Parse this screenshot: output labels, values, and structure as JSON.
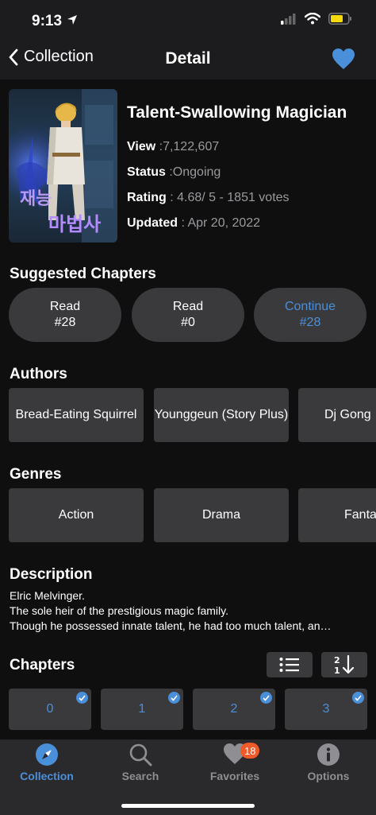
{
  "status_bar": {
    "time": "9:13"
  },
  "nav": {
    "back_label": "Collection",
    "title": "Detail"
  },
  "manga": {
    "title": "Talent-Swallowing Magician",
    "view_label": "View",
    "view_value": " :7,122,607",
    "status_label": "Status",
    "status_value": " :Ongoing",
    "rating_label": "Rating",
    "rating_value": " : 4.68/ 5  - 1851 votes",
    "updated_label": "Updated",
    "updated_value": " : Apr 20, 2022"
  },
  "suggested": {
    "title": "Suggested Chapters",
    "items": [
      {
        "line1": "Read",
        "line2": "#28"
      },
      {
        "line1": "Read",
        "line2": "#0"
      },
      {
        "line1": "Continue",
        "line2": "#28"
      }
    ]
  },
  "authors": {
    "title": "Authors",
    "items": [
      "Bread-Eating Squirrel",
      "Younggeun (Story Plus)",
      "Dj Gong"
    ]
  },
  "genres": {
    "title": "Genres",
    "items": [
      "Action",
      "Drama",
      "Fantasy"
    ]
  },
  "description": {
    "title": "Description",
    "lines": [
      "Elric Melvinger.",
      "The sole heir of the prestigious magic family.",
      "Though he possessed innate talent, he had too much talent, an…"
    ]
  },
  "chapters": {
    "title": "Chapters",
    "items": [
      "0",
      "1",
      "2",
      "3"
    ]
  },
  "tabbar": {
    "items": [
      "Collection",
      "Search",
      "Favorites",
      "Options"
    ],
    "favorites_badge": "18"
  },
  "colors": {
    "accent": "#4a8fd9",
    "badge": "#f05a28",
    "background": "#0f0f10"
  }
}
